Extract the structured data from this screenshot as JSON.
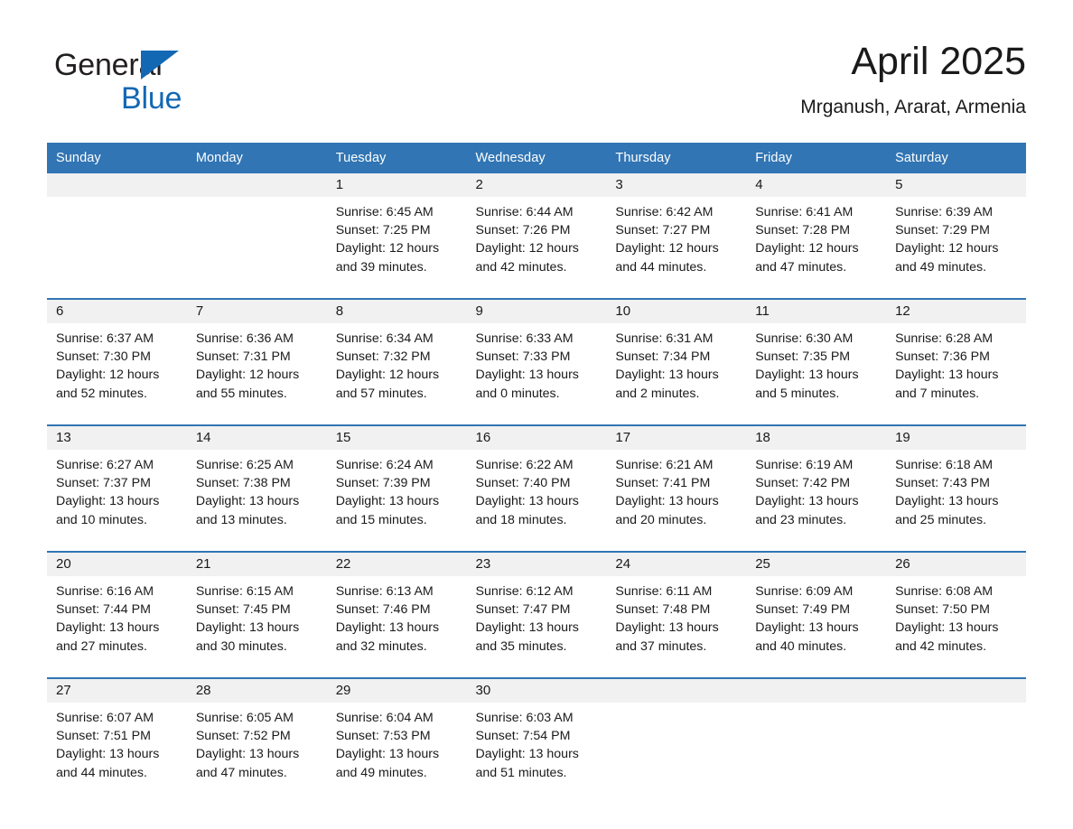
{
  "brand": {
    "name_part1": "General",
    "name_part2": "Blue",
    "triangle_color": "#1268b3",
    "text_color": "#231f20"
  },
  "header": {
    "month_title": "April 2025",
    "location": "Mrganush, Ararat, Armenia"
  },
  "theme": {
    "header_blue": "#3175b4",
    "daynum_band": "#f1f1f1",
    "text": "#1a1a1a",
    "page_background": "#ffffff"
  },
  "calendar": {
    "weekday_headers": [
      "Sunday",
      "Monday",
      "Tuesday",
      "Wednesday",
      "Thursday",
      "Friday",
      "Saturday"
    ],
    "labels": {
      "sunrise_prefix": "Sunrise:",
      "sunset_prefix": "Sunset:",
      "daylight_prefix": "Daylight:"
    },
    "weeks": [
      [
        {
          "empty": true
        },
        {
          "empty": true
        },
        {
          "day": "1",
          "sunrise": "Sunrise: 6:45 AM",
          "sunset": "Sunset: 7:25 PM",
          "daylight_line1": "Daylight: 12 hours",
          "daylight_line2": "and 39 minutes."
        },
        {
          "day": "2",
          "sunrise": "Sunrise: 6:44 AM",
          "sunset": "Sunset: 7:26 PM",
          "daylight_line1": "Daylight: 12 hours",
          "daylight_line2": "and 42 minutes."
        },
        {
          "day": "3",
          "sunrise": "Sunrise: 6:42 AM",
          "sunset": "Sunset: 7:27 PM",
          "daylight_line1": "Daylight: 12 hours",
          "daylight_line2": "and 44 minutes."
        },
        {
          "day": "4",
          "sunrise": "Sunrise: 6:41 AM",
          "sunset": "Sunset: 7:28 PM",
          "daylight_line1": "Daylight: 12 hours",
          "daylight_line2": "and 47 minutes."
        },
        {
          "day": "5",
          "sunrise": "Sunrise: 6:39 AM",
          "sunset": "Sunset: 7:29 PM",
          "daylight_line1": "Daylight: 12 hours",
          "daylight_line2": "and 49 minutes."
        }
      ],
      [
        {
          "day": "6",
          "sunrise": "Sunrise: 6:37 AM",
          "sunset": "Sunset: 7:30 PM",
          "daylight_line1": "Daylight: 12 hours",
          "daylight_line2": "and 52 minutes."
        },
        {
          "day": "7",
          "sunrise": "Sunrise: 6:36 AM",
          "sunset": "Sunset: 7:31 PM",
          "daylight_line1": "Daylight: 12 hours",
          "daylight_line2": "and 55 minutes."
        },
        {
          "day": "8",
          "sunrise": "Sunrise: 6:34 AM",
          "sunset": "Sunset: 7:32 PM",
          "daylight_line1": "Daylight: 12 hours",
          "daylight_line2": "and 57 minutes."
        },
        {
          "day": "9",
          "sunrise": "Sunrise: 6:33 AM",
          "sunset": "Sunset: 7:33 PM",
          "daylight_line1": "Daylight: 13 hours",
          "daylight_line2": "and 0 minutes."
        },
        {
          "day": "10",
          "sunrise": "Sunrise: 6:31 AM",
          "sunset": "Sunset: 7:34 PM",
          "daylight_line1": "Daylight: 13 hours",
          "daylight_line2": "and 2 minutes."
        },
        {
          "day": "11",
          "sunrise": "Sunrise: 6:30 AM",
          "sunset": "Sunset: 7:35 PM",
          "daylight_line1": "Daylight: 13 hours",
          "daylight_line2": "and 5 minutes."
        },
        {
          "day": "12",
          "sunrise": "Sunrise: 6:28 AM",
          "sunset": "Sunset: 7:36 PM",
          "daylight_line1": "Daylight: 13 hours",
          "daylight_line2": "and 7 minutes."
        }
      ],
      [
        {
          "day": "13",
          "sunrise": "Sunrise: 6:27 AM",
          "sunset": "Sunset: 7:37 PM",
          "daylight_line1": "Daylight: 13 hours",
          "daylight_line2": "and 10 minutes."
        },
        {
          "day": "14",
          "sunrise": "Sunrise: 6:25 AM",
          "sunset": "Sunset: 7:38 PM",
          "daylight_line1": "Daylight: 13 hours",
          "daylight_line2": "and 13 minutes."
        },
        {
          "day": "15",
          "sunrise": "Sunrise: 6:24 AM",
          "sunset": "Sunset: 7:39 PM",
          "daylight_line1": "Daylight: 13 hours",
          "daylight_line2": "and 15 minutes."
        },
        {
          "day": "16",
          "sunrise": "Sunrise: 6:22 AM",
          "sunset": "Sunset: 7:40 PM",
          "daylight_line1": "Daylight: 13 hours",
          "daylight_line2": "and 18 minutes."
        },
        {
          "day": "17",
          "sunrise": "Sunrise: 6:21 AM",
          "sunset": "Sunset: 7:41 PM",
          "daylight_line1": "Daylight: 13 hours",
          "daylight_line2": "and 20 minutes."
        },
        {
          "day": "18",
          "sunrise": "Sunrise: 6:19 AM",
          "sunset": "Sunset: 7:42 PM",
          "daylight_line1": "Daylight: 13 hours",
          "daylight_line2": "and 23 minutes."
        },
        {
          "day": "19",
          "sunrise": "Sunrise: 6:18 AM",
          "sunset": "Sunset: 7:43 PM",
          "daylight_line1": "Daylight: 13 hours",
          "daylight_line2": "and 25 minutes."
        }
      ],
      [
        {
          "day": "20",
          "sunrise": "Sunrise: 6:16 AM",
          "sunset": "Sunset: 7:44 PM",
          "daylight_line1": "Daylight: 13 hours",
          "daylight_line2": "and 27 minutes."
        },
        {
          "day": "21",
          "sunrise": "Sunrise: 6:15 AM",
          "sunset": "Sunset: 7:45 PM",
          "daylight_line1": "Daylight: 13 hours",
          "daylight_line2": "and 30 minutes."
        },
        {
          "day": "22",
          "sunrise": "Sunrise: 6:13 AM",
          "sunset": "Sunset: 7:46 PM",
          "daylight_line1": "Daylight: 13 hours",
          "daylight_line2": "and 32 minutes."
        },
        {
          "day": "23",
          "sunrise": "Sunrise: 6:12 AM",
          "sunset": "Sunset: 7:47 PM",
          "daylight_line1": "Daylight: 13 hours",
          "daylight_line2": "and 35 minutes."
        },
        {
          "day": "24",
          "sunrise": "Sunrise: 6:11 AM",
          "sunset": "Sunset: 7:48 PM",
          "daylight_line1": "Daylight: 13 hours",
          "daylight_line2": "and 37 minutes."
        },
        {
          "day": "25",
          "sunrise": "Sunrise: 6:09 AM",
          "sunset": "Sunset: 7:49 PM",
          "daylight_line1": "Daylight: 13 hours",
          "daylight_line2": "and 40 minutes."
        },
        {
          "day": "26",
          "sunrise": "Sunrise: 6:08 AM",
          "sunset": "Sunset: 7:50 PM",
          "daylight_line1": "Daylight: 13 hours",
          "daylight_line2": "and 42 minutes."
        }
      ],
      [
        {
          "day": "27",
          "sunrise": "Sunrise: 6:07 AM",
          "sunset": "Sunset: 7:51 PM",
          "daylight_line1": "Daylight: 13 hours",
          "daylight_line2": "and 44 minutes."
        },
        {
          "day": "28",
          "sunrise": "Sunrise: 6:05 AM",
          "sunset": "Sunset: 7:52 PM",
          "daylight_line1": "Daylight: 13 hours",
          "daylight_line2": "and 47 minutes."
        },
        {
          "day": "29",
          "sunrise": "Sunrise: 6:04 AM",
          "sunset": "Sunset: 7:53 PM",
          "daylight_line1": "Daylight: 13 hours",
          "daylight_line2": "and 49 minutes."
        },
        {
          "day": "30",
          "sunrise": "Sunrise: 6:03 AM",
          "sunset": "Sunset: 7:54 PM",
          "daylight_line1": "Daylight: 13 hours",
          "daylight_line2": "and 51 minutes."
        },
        {
          "empty": true
        },
        {
          "empty": true
        },
        {
          "empty": true
        }
      ]
    ]
  }
}
